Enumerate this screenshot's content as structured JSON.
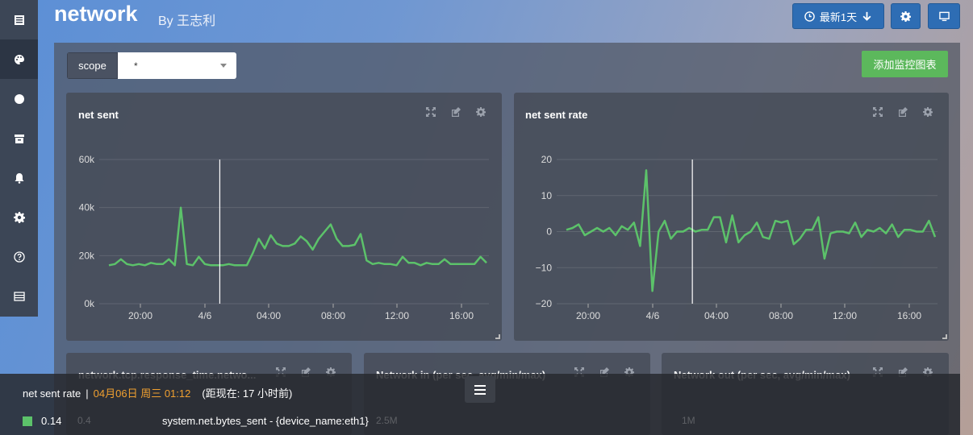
{
  "header": {
    "title": "network",
    "subtitle": "By  王志利",
    "time_button": "最新1天",
    "time_icon": "clock-icon",
    "settings_icon": "gear-icon",
    "display_icon": "monitor-icon"
  },
  "sidebar": {
    "items": [
      {
        "icon": "dashboard-list-icon"
      },
      {
        "icon": "palette-icon"
      },
      {
        "icon": "circle-icon"
      },
      {
        "icon": "archive-icon"
      },
      {
        "icon": "bell-icon"
      },
      {
        "icon": "gear-icon"
      },
      {
        "icon": "help-icon"
      },
      {
        "icon": "table-icon"
      }
    ]
  },
  "toolbar": {
    "scope_label": "scope",
    "scope_value": "*",
    "add_chart": "添加监控图表"
  },
  "colors": {
    "series": "#5cc26a",
    "accent": "#2e6db4",
    "add_button": "#5cb85c",
    "tooltip_time": "#f0a030"
  },
  "charts": {
    "net_sent": {
      "title": "net sent"
    },
    "net_sent_rate": {
      "title": "net sent rate"
    },
    "tcp": {
      "title": "network.tcp.response_time.netwo..."
    },
    "net_in": {
      "title": "Network in (per sec, avg/min/max)",
      "ytick": "2.5M"
    },
    "net_out": {
      "title": "Network out (per sec, avg/min/max)",
      "ytick": "1M"
    },
    "tcp_ytick": "0.4"
  },
  "chart_data": [
    {
      "type": "line",
      "title": "net sent",
      "x_ticks": [
        "20:00",
        "4/6",
        "04:00",
        "08:00",
        "12:00",
        "16:00"
      ],
      "y_ticks": [
        "0k",
        "20k",
        "40k",
        "60k"
      ],
      "ylim": [
        0,
        60000
      ],
      "series": [
        {
          "values": [
            16000,
            16500,
            18500,
            16500,
            16000,
            16500,
            16000,
            17000,
            16500,
            16500,
            18500,
            16000,
            40000,
            16500,
            16000,
            19500,
            16500,
            16000,
            16000,
            16000,
            16500,
            16000,
            16000,
            16000,
            21000,
            27000,
            23000,
            28500,
            25000,
            24000,
            24000,
            25000,
            28000,
            26000,
            22500,
            27000,
            30000,
            33000,
            27000,
            24000,
            24000,
            24500,
            29000,
            18000,
            16500,
            17000,
            16500,
            16500,
            16000,
            19500,
            17000,
            17000,
            16000,
            17000,
            16500,
            16500,
            18500,
            16500,
            16500,
            16500,
            16500,
            16500,
            19500,
            17000
          ]
        }
      ],
      "cursor_index": 18.5,
      "grid": true
    },
    {
      "type": "line",
      "title": "net sent rate",
      "x_ticks": [
        "20:00",
        "4/6",
        "04:00",
        "08:00",
        "12:00",
        "16:00"
      ],
      "y_ticks": [
        "−20",
        "−10",
        "0",
        "10",
        "20"
      ],
      "ylim": [
        -20,
        20
      ],
      "series": [
        {
          "values": [
            0.5,
            1,
            2,
            -1,
            0,
            1,
            0,
            1,
            -1,
            1.5,
            0.5,
            2.5,
            -4,
            17,
            -16.5,
            0,
            3,
            -2,
            0,
            0,
            1,
            0,
            0.5,
            0.5,
            4,
            4,
            -3,
            4.5,
            -3,
            -1,
            0,
            2.5,
            -1.5,
            -2,
            3,
            2.5,
            3,
            -3.5,
            -2,
            0.5,
            0.5,
            4,
            -7.5,
            -0.5,
            0,
            0,
            -0.5,
            2.5,
            -1.5,
            0.5,
            0,
            1,
            -0.5,
            2,
            -1.5,
            0.5,
            0.5,
            0,
            0,
            3,
            -1.5
          ]
        }
      ],
      "cursor_index": 20.5,
      "grid": true
    }
  ],
  "tooltip": {
    "series_name": "net sent rate",
    "separator": "|",
    "time": "04月06日 周三 01:12",
    "relative": "(距现在:  17 小时前)",
    "value": "0.14",
    "series_label": "system.net.bytes_sent - {device_name:eth1}"
  }
}
